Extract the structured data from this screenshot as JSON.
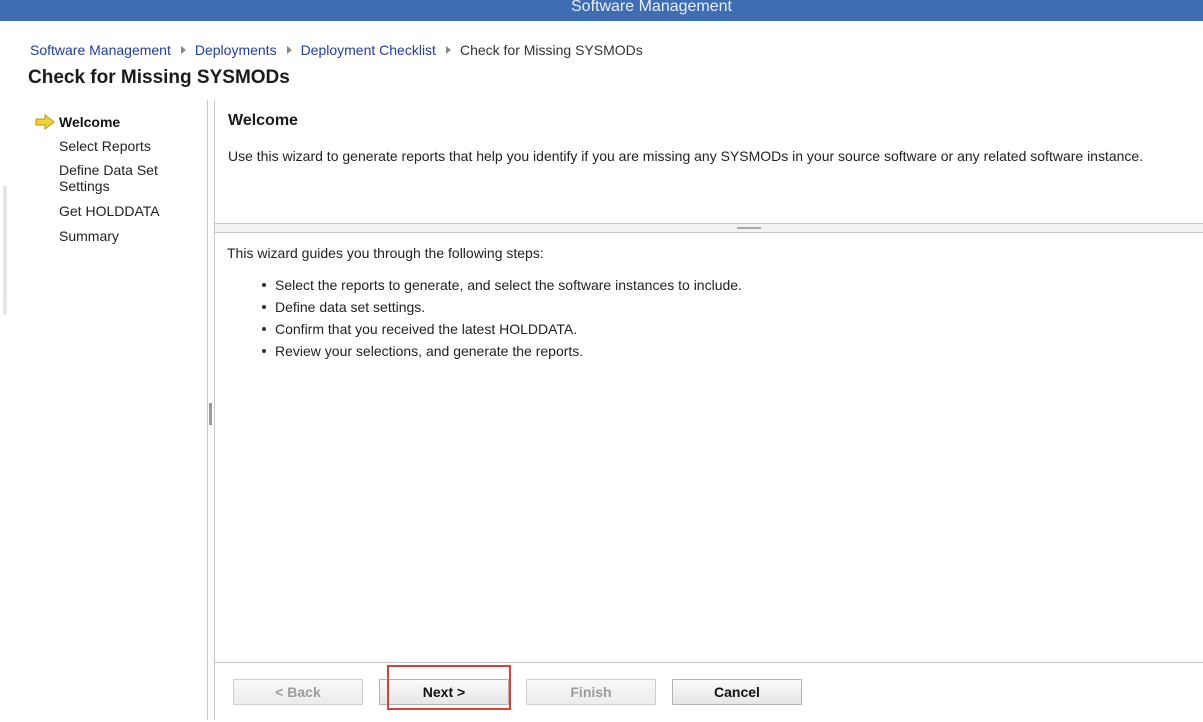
{
  "window": {
    "title": "Software Management"
  },
  "breadcrumb": {
    "items": [
      "Software Management",
      "Deployments",
      "Deployment Checklist"
    ],
    "current": "Check for Missing SYSMODs"
  },
  "page": {
    "title": "Check for Missing SYSMODs"
  },
  "steps": {
    "current_index": 0,
    "items": [
      {
        "label": "Welcome"
      },
      {
        "label": "Select Reports"
      },
      {
        "label": "Define Data Set Settings"
      },
      {
        "label": "Get HOLDDATA"
      },
      {
        "label": "Summary"
      }
    ]
  },
  "welcome": {
    "heading": "Welcome",
    "intro": "Use this wizard to generate reports that help you identify if you are missing any SYSMODs in your source software or any related software instance."
  },
  "guide": {
    "intro": "This wizard guides you through the following steps:",
    "bullets": [
      "Select the reports to generate, and select the software instances to include.",
      "Define data set settings.",
      "Confirm that you received the latest HOLDDATA.",
      "Review your selections, and generate the reports."
    ]
  },
  "buttons": {
    "back": "< Back",
    "next": "Next >",
    "finish": "Finish",
    "cancel": "Cancel"
  },
  "colors": {
    "title_bar": "#3e6db2",
    "link": "#1f3ea3",
    "highlight": "#e03c3c",
    "arrow": "#f2d23a"
  },
  "icons": {
    "current_step": "arrow-right-icon",
    "breadcrumb_separator": "triangle-right-icon"
  }
}
